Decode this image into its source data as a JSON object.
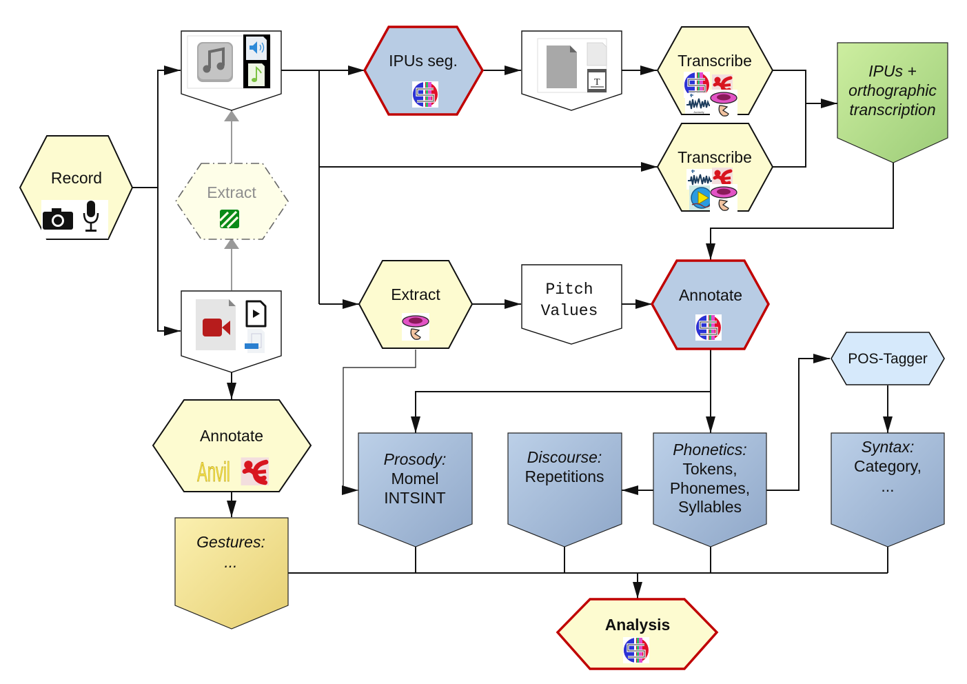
{
  "diagram": {
    "nodes": {
      "record": {
        "label": "Record",
        "icons": [
          "camera-icon",
          "microphone-icon"
        ]
      },
      "audio_file": {
        "label": "",
        "icons": [
          "music-file-icon",
          "audio-file-icon",
          "music-note-file-icon"
        ]
      },
      "extract_audio": {
        "label": "Extract",
        "icons": [
          "ffmpeg-icon"
        ],
        "state": "optional"
      },
      "video_file": {
        "label": "",
        "icons": [
          "video-file-icon",
          "play-file-icon",
          "video-badge-file-icon"
        ]
      },
      "ipus_seg": {
        "label": "IPUs seg.",
        "icons": [
          "sppas-icon"
        ]
      },
      "text_file": {
        "label": "",
        "icons": [
          "document-file-icon",
          "blank-file-icon",
          "text-document-icon"
        ]
      },
      "transcribe_1": {
        "label": "Transcribe",
        "icons": [
          "sppas-icon",
          "elan-icon",
          "audacity-icon",
          "praat-icon"
        ]
      },
      "transcribe_2": {
        "label": "Transcribe",
        "icons": [
          "audacity-icon",
          "elan-icon",
          "transcriber-icon",
          "praat-icon"
        ]
      },
      "ipus_ortho": {
        "line1": "IPUs +",
        "line2": "orthographic",
        "line3": "transcription"
      },
      "extract_pitch": {
        "label": "Extract",
        "icons": [
          "praat-icon"
        ]
      },
      "pitch_values": {
        "line1": "Pitch",
        "line2": "Values"
      },
      "annotate_sppas": {
        "label": "Annotate",
        "icons": [
          "sppas-icon"
        ]
      },
      "annotate_gestures": {
        "label": "Annotate",
        "icons": [
          "anvil-icon",
          "elan-icon"
        ],
        "anvil_text": "Anvil"
      },
      "pos_tagger": {
        "label": "POS-Tagger"
      },
      "prosody": {
        "title": "Prosody:",
        "line1": "Momel",
        "line2": "INTSINT"
      },
      "discourse": {
        "title": "Discourse:",
        "line1": "Repetitions"
      },
      "phonetics": {
        "title": "Phonetics:",
        "line1": "Tokens,",
        "line2": "Phonemes,",
        "line3": "Syllables"
      },
      "syntax": {
        "title": "Syntax:",
        "line1": "Category,",
        "line2": "..."
      },
      "gestures": {
        "title": "Gestures:",
        "line1": "..."
      },
      "analysis": {
        "label": "Analysis",
        "icons": [
          "sppas-icon"
        ]
      }
    },
    "colors": {
      "process_fill": "#fdfbd0",
      "sppas_process_fill": "#b8cce4",
      "sppas_border": "#c00000",
      "pos_tagger_fill": "#d6e9fb",
      "annotation_blue_top": "#bcd0e8",
      "annotation_blue_bottom": "#8fa7c8",
      "output_green_top": "#cdeea0",
      "output_green_bottom": "#9ccc78",
      "gesture_gold_top": "#fbf0b0",
      "gesture_gold_bottom": "#e6cf72"
    }
  }
}
